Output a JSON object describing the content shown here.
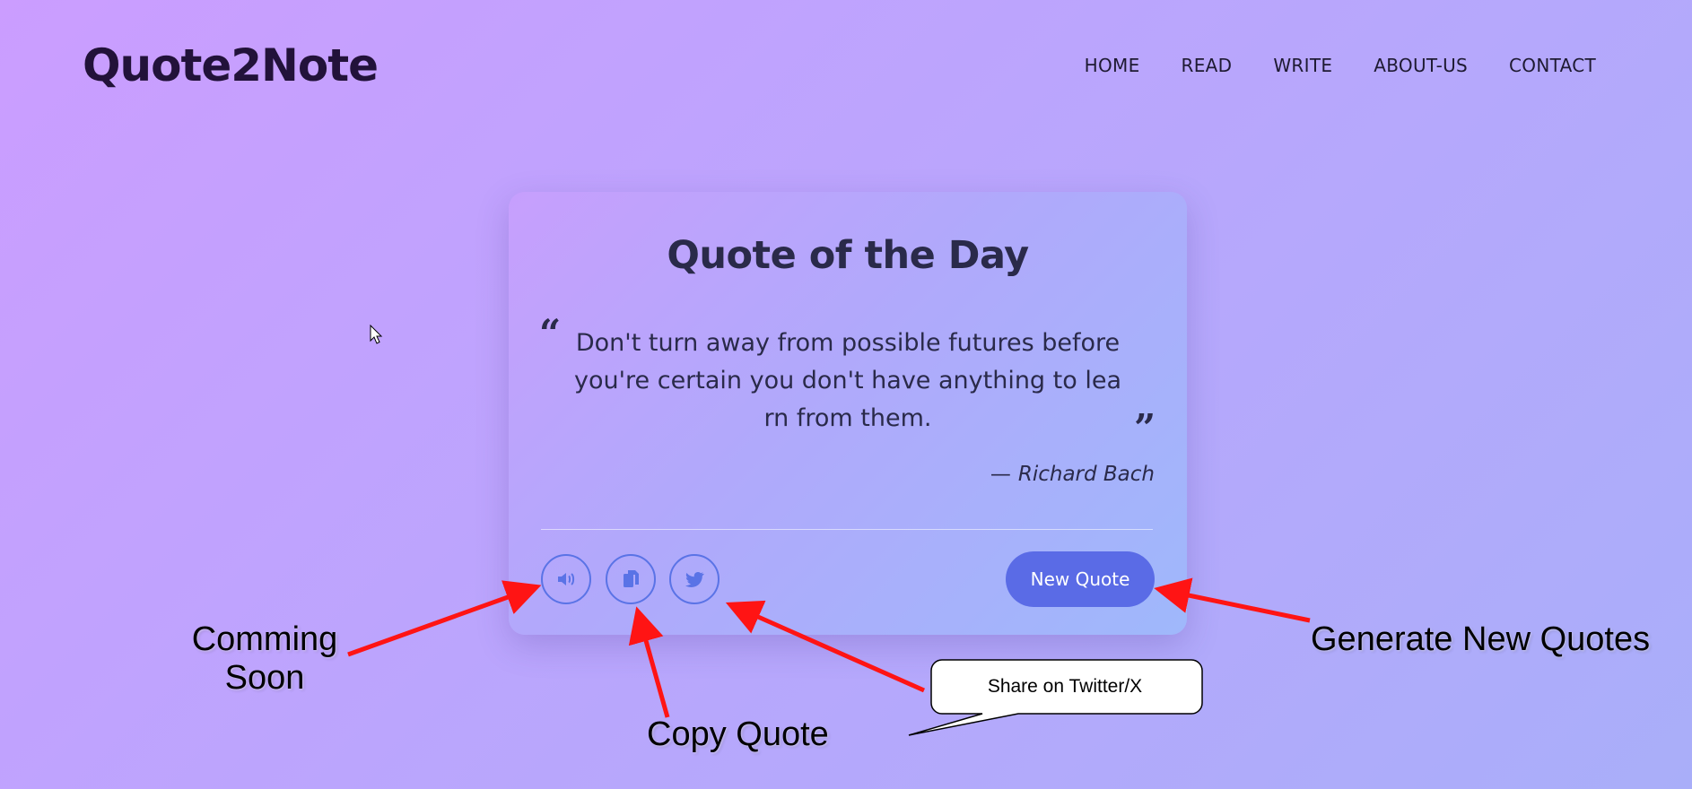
{
  "header": {
    "brand": "Quote2Note",
    "nav": [
      "HOME",
      "READ",
      "WRITE",
      "ABOUT-US",
      "CONTACT"
    ]
  },
  "card": {
    "title": "Quote of the Day",
    "open_quote_glyph": "“",
    "close_quote_glyph": "”",
    "quote_lines": [
      "Don't turn away from possible futures before",
      "you're certain you don't have anything to lea",
      "rn from them."
    ],
    "author_dash": "—",
    "author": "Richard Bach",
    "actions": {
      "speak_icon": "speaker-icon",
      "copy_icon": "copy-icon",
      "tweet_icon": "twitter-icon",
      "new_quote_label": "New Quote"
    }
  },
  "annotations": {
    "coming_soon_line1": "Comming",
    "coming_soon_line2": "Soon",
    "copy_quote": "Copy Quote",
    "generate": "Generate New Quotes",
    "share_callout": "Share on Twitter/X"
  },
  "colors": {
    "accent": "#5a6be6",
    "arrow": "#ff1414",
    "text_dark": "#2a2a4a"
  }
}
